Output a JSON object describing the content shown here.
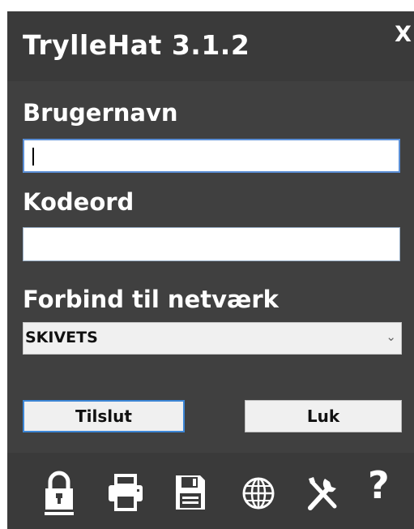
{
  "window": {
    "title": "TrylleHat 3.1.2",
    "close_label": "X"
  },
  "form": {
    "username_label": "Brugernavn",
    "username_value": "",
    "password_label": "Kodeord",
    "password_value": "",
    "network_label": "Forbind til netværk",
    "network_selected": "SKIVETS",
    "network_arrow": "⌄"
  },
  "buttons": {
    "connect_label": "Tilslut",
    "close_label": "Luk"
  },
  "toolbar": {
    "icons": [
      "lock-icon",
      "printer-icon",
      "save-icon",
      "globe-icon",
      "tools-icon",
      "help-icon"
    ],
    "help_label": "?"
  },
  "colors": {
    "panel": "#404040",
    "titlebar": "#3a3a3a",
    "focus": "#5b8fd6"
  }
}
